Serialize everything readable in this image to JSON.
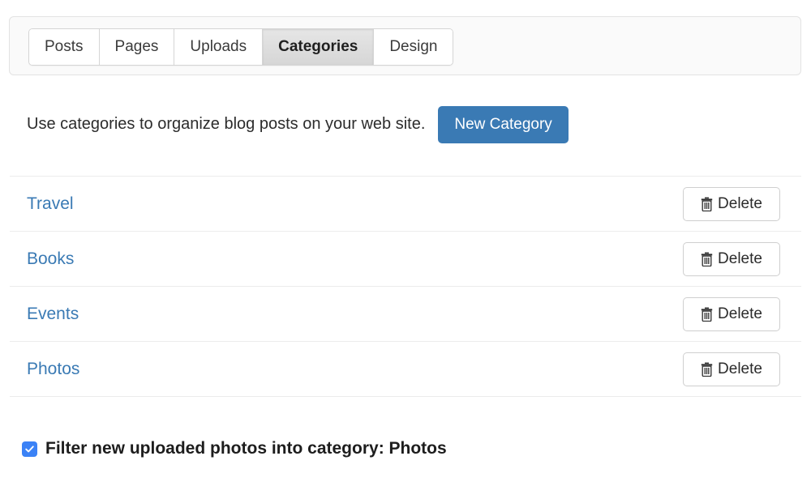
{
  "tabs": [
    {
      "label": "Posts",
      "active": false
    },
    {
      "label": "Pages",
      "active": false
    },
    {
      "label": "Uploads",
      "active": false
    },
    {
      "label": "Categories",
      "active": true
    },
    {
      "label": "Design",
      "active": false
    }
  ],
  "description": {
    "text": "Use categories to organize blog posts on your web site.",
    "new_category_label": "New Category"
  },
  "categories": [
    {
      "name": "Travel",
      "delete_label": "Delete",
      "delete_icon": "trash-icon"
    },
    {
      "name": "Books",
      "delete_label": "Delete",
      "delete_icon": "trash-icon"
    },
    {
      "name": "Events",
      "delete_label": "Delete",
      "delete_icon": "trash-icon"
    },
    {
      "name": "Photos",
      "delete_label": "Delete",
      "delete_icon": "trash-icon"
    }
  ],
  "filter": {
    "checked": true,
    "check_icon": "check-icon",
    "label": "Filter new uploaded photos into category: Photos"
  },
  "colors": {
    "link": "#3a7ab4",
    "primary_button": "#3a7ab4",
    "checkbox": "#3b82f6",
    "panel_bg": "#fafafa",
    "divider": "#ececec",
    "active_tab_bg": "#dcdcdc"
  }
}
